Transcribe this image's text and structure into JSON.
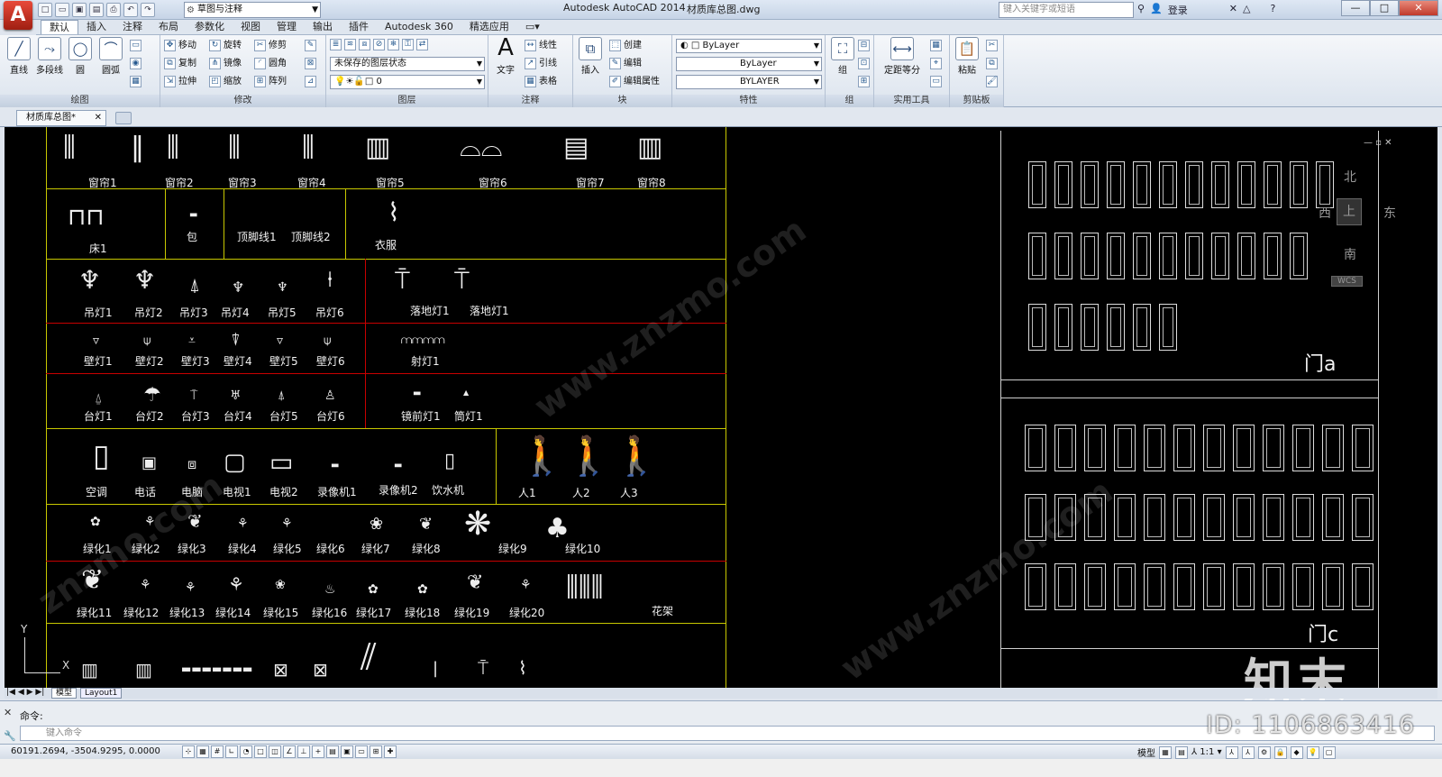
{
  "title": {
    "app": "Autodesk AutoCAD 2014",
    "file": "材质库总图.dwg",
    "workspace": "草图与注释",
    "search_placeholder": "键入关键字或短语",
    "login": "登录"
  },
  "tabs": [
    "默认",
    "插入",
    "注释",
    "布局",
    "参数化",
    "视图",
    "管理",
    "输出",
    "插件",
    "Autodesk 360",
    "精选应用"
  ],
  "ribbon": {
    "draw": {
      "title": "绘图",
      "line": "直线",
      "polyline": "多段线",
      "circle": "圆",
      "arc": "圆弧"
    },
    "modify": {
      "title": "修改",
      "move": "移动",
      "rotate": "旋转",
      "trim": "修剪",
      "copy": "复制",
      "mirror": "镜像",
      "fillet": "圆角",
      "stretch": "拉伸",
      "scale": "缩放",
      "array": "阵列"
    },
    "layers": {
      "title": "图层",
      "state": "未保存的图层状态",
      "current": "0"
    },
    "annotation": {
      "title": "注释",
      "text": "文字",
      "dim": "线性",
      "leader": "引线",
      "table": "表格"
    },
    "block": {
      "title": "块",
      "insert": "插入",
      "create": "创建",
      "edit": "编辑",
      "attr": "编辑属性"
    },
    "properties": {
      "title": "特性",
      "color": "ByLayer",
      "linetype": "ByLayer",
      "lineweight": "BYLAYER"
    },
    "groups": {
      "title": "组",
      "group": "组"
    },
    "utilities": {
      "title": "实用工具",
      "measure": "定距等分"
    },
    "clipboard": {
      "title": "剪贴板",
      "paste": "粘贴"
    }
  },
  "doc_tab": "材质库总图*",
  "canvas": {
    "row_curtains": [
      "窗帘1",
      "窗帘2",
      "窗帘3",
      "窗帘4",
      "窗帘5",
      "窗帘6",
      "窗帘7",
      "窗帘8"
    ],
    "row_misc": [
      "床1",
      "包",
      "顶脚线1",
      "顶脚线2",
      "衣服"
    ],
    "row_pendant": [
      "吊灯1",
      "吊灯2",
      "吊灯3",
      "吊灯4",
      "吊灯5",
      "吊灯6",
      "落地灯1",
      "落地灯1"
    ],
    "row_wall": [
      "壁灯1",
      "壁灯2",
      "壁灯3",
      "壁灯4",
      "壁灯5",
      "壁灯6",
      "射灯1"
    ],
    "row_table": [
      "台灯1",
      "台灯2",
      "台灯3",
      "台灯4",
      "台灯5",
      "台灯6",
      "镜前灯1",
      "筒灯1"
    ],
    "row_appliance": [
      "空调",
      "电话",
      "电脑",
      "电视1",
      "电视2",
      "录像机1",
      "录像机2",
      "饮水机",
      "人1",
      "人2",
      "人3"
    ],
    "row_green1": [
      "绿化1",
      "绿化2",
      "绿化3",
      "绿化4",
      "绿化5",
      "绿化6",
      "绿化7",
      "绿化8",
      "绿化9",
      "绿化10"
    ],
    "row_green2": [
      "绿化11",
      "绿化12",
      "绿化13",
      "绿化14",
      "绿化15",
      "绿化16",
      "绿化17",
      "绿化18",
      "绿化19",
      "绿化20",
      "花架"
    ],
    "door_a": "门a",
    "door_c": "门c",
    "compass": {
      "n": "北",
      "s": "南",
      "e": "东",
      "w": "西",
      "top": "上",
      "wcs": "WCS"
    },
    "ucs_y": "Y",
    "ucs_x": "X"
  },
  "layout_tabs": [
    "模型",
    "Layout1"
  ],
  "command": {
    "history": "命令:",
    "placeholder": "键入命令"
  },
  "status": {
    "coords": "60191.2694, -3504.9295, 0.0000",
    "model": "模型",
    "scale": "1:1"
  },
  "watermark": {
    "logo": "知末",
    "id": "ID: 1106863416"
  }
}
